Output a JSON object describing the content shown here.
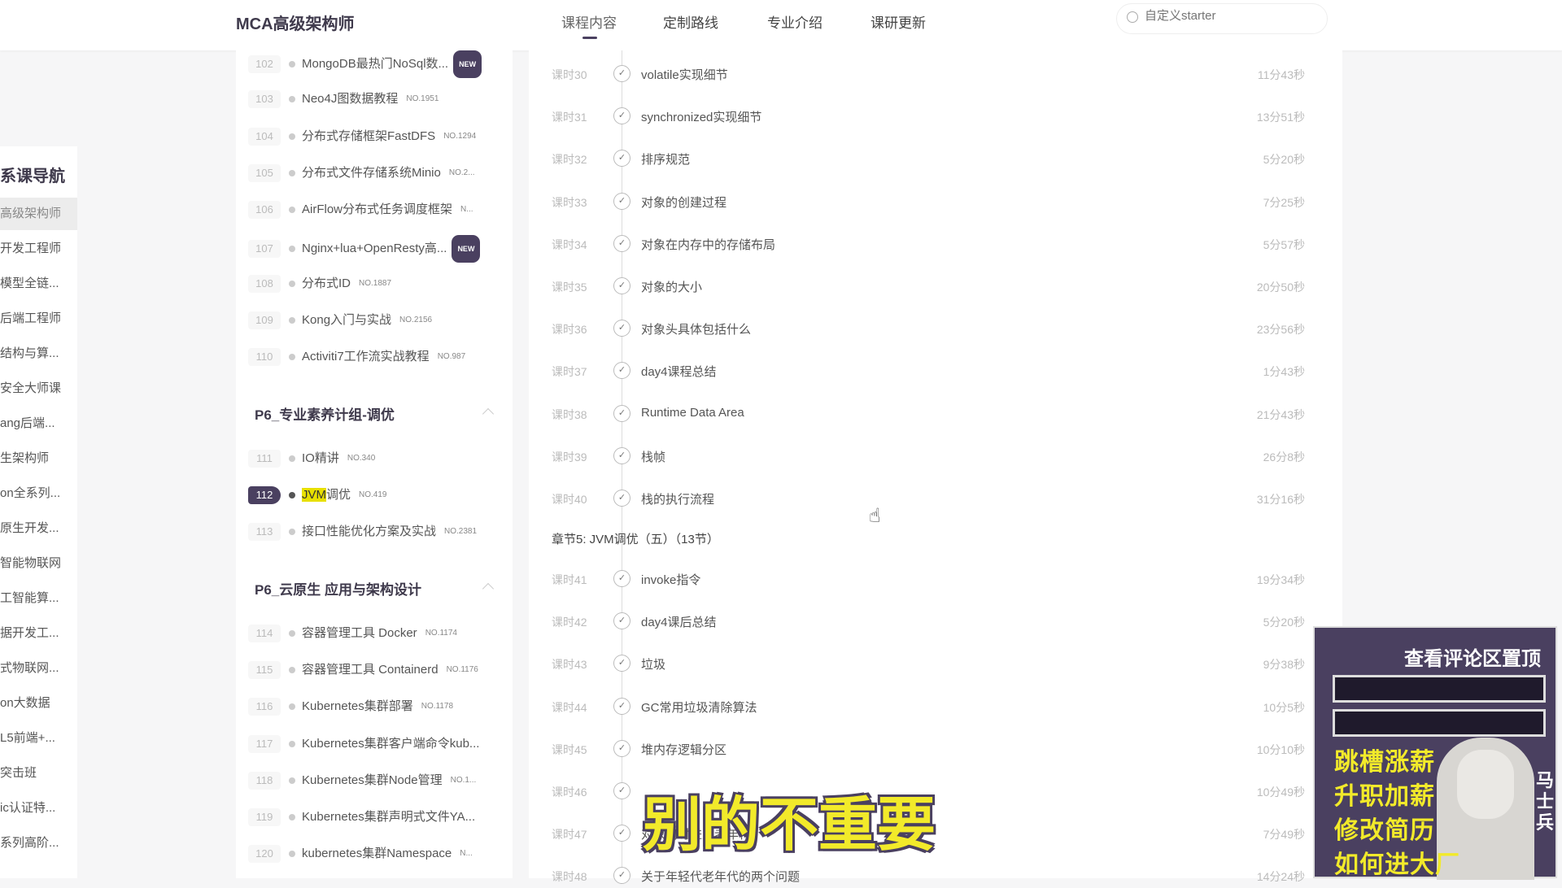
{
  "header": {
    "title": "MCA高级架构师",
    "tabs": [
      "课程内容",
      "定制路线",
      "专业介绍",
      "课研更新"
    ],
    "active_tab": 0,
    "search_placeholder": "自定义starter"
  },
  "sidebar": {
    "title": "系课导航",
    "items": [
      "高级架构师",
      "开发工程师",
      "模型全链...",
      "后端工程师",
      "结构与算...",
      "安全大师课",
      "ang后端...",
      "生架构师",
      "on全系列...",
      "原生开发...",
      "智能物联网",
      "工智能算...",
      "据开发工...",
      "式物联网...",
      "on大数据",
      "L5前端+...",
      "突击班",
      "ic认证特...",
      "系列高阶..."
    ],
    "selected": 0
  },
  "courses": {
    "items": [
      {
        "num": "102",
        "title": "MongoDB最热门NoSql数...",
        "no": "",
        "badge": "NEW"
      },
      {
        "num": "103",
        "title": "Neo4J图数据教程",
        "no": "NO.1951"
      },
      {
        "num": "104",
        "title": "分布式存储框架FastDFS",
        "no": "NO.1294"
      },
      {
        "num": "105",
        "title": "分布式文件存储系统Minio",
        "no": "NO.2..."
      },
      {
        "num": "106",
        "title": "AirFlow分布式任务调度框架",
        "no": "N..."
      },
      {
        "num": "107",
        "title": "Nginx+lua+OpenResty高...",
        "no": "",
        "badge": "NEW"
      },
      {
        "num": "108",
        "title": "分布式ID",
        "no": "NO.1887"
      },
      {
        "num": "109",
        "title": "Kong入门与实战",
        "no": "NO.2156"
      },
      {
        "num": "110",
        "title": "Activiti7工作流实战教程",
        "no": "NO.987"
      },
      {
        "section": "P6_专业素养计组-调优"
      },
      {
        "num": "111",
        "title": "IO精讲",
        "no": "NO.340"
      },
      {
        "num": "112",
        "title": "JVM调优",
        "highlight": "JVM",
        "rest": "调优",
        "no": "NO.419",
        "selected": true
      },
      {
        "num": "113",
        "title": "接口性能优化方案及实战",
        "no": "NO.2381"
      },
      {
        "section": "P6_云原生 应用与架构设计"
      },
      {
        "num": "114",
        "title": "容器管理工具 Docker",
        "no": "NO.1174"
      },
      {
        "num": "115",
        "title": "容器管理工具 Containerd",
        "no": "NO.1176"
      },
      {
        "num": "116",
        "title": "Kubernetes集群部署",
        "no": "NO.1178"
      },
      {
        "num": "117",
        "title": "Kubernetes集群客户端命令kub...",
        "no": ""
      },
      {
        "num": "118",
        "title": "Kubernetes集群Node管理",
        "no": "NO.1..."
      },
      {
        "num": "119",
        "title": "Kubernetes集群声明式文件YA...",
        "no": ""
      },
      {
        "num": "120",
        "title": "kubernetes集群Namespace",
        "no": "N..."
      }
    ]
  },
  "lessons_a": [
    {
      "no": "课时30",
      "title": "volatile实现细节",
      "dur": "11分43秒"
    },
    {
      "no": "课时31",
      "title": "synchronized实现细节",
      "dur": "13分51秒"
    },
    {
      "no": "课时32",
      "title": "排序规范",
      "dur": "5分20秒"
    },
    {
      "no": "课时33",
      "title": "对象的创建过程",
      "dur": "7分25秒"
    },
    {
      "no": "课时34",
      "title": "对象在内存中的存储布局",
      "dur": "5分57秒"
    },
    {
      "no": "课时35",
      "title": "对象的大小",
      "dur": "20分50秒"
    },
    {
      "no": "课时36",
      "title": "对象头具体包括什么",
      "dur": "23分56秒"
    },
    {
      "no": "课时37",
      "title": "day4课程总结",
      "dur": "1分43秒"
    },
    {
      "no": "课时38",
      "title": "Runtime Data Area",
      "dur": "21分43秒"
    },
    {
      "no": "课时39",
      "title": "栈帧",
      "dur": "26分8秒"
    },
    {
      "no": "课时40",
      "title": "栈的执行流程",
      "dur": "31分16秒"
    }
  ],
  "chapter": "章节5: JVM调优（五）（13节）",
  "lessons_b": [
    {
      "no": "课时41",
      "title": "invoke指令",
      "dur": "19分34秒"
    },
    {
      "no": "课时42",
      "title": "day4课后总结",
      "dur": "5分20秒"
    },
    {
      "no": "课时43",
      "title": "垃圾",
      "dur": "9分38秒"
    },
    {
      "no": "课时44",
      "title": "GC常用垃圾清除算法",
      "dur": "10分5秒"
    },
    {
      "no": "课时45",
      "title": "堆内存逻辑分区",
      "dur": "10分10秒"
    },
    {
      "no": "课时46",
      "title": "",
      "dur": "10分49秒"
    },
    {
      "no": "课时47",
      "title": "对象何时进入老年代",
      "dur": "7分49秒"
    },
    {
      "no": "课时48",
      "title": "关于年轻代老年代的两个问题",
      "dur": "14分24秒"
    }
  ],
  "subtitle": "别的不重要",
  "ad": {
    "top": "查看评论区置顶",
    "lines": [
      "跳槽涨薪",
      "升职加薪",
      "修改简历",
      "如何进大厂"
    ],
    "name": "马士兵"
  },
  "colors": {
    "accent": "#4a4060",
    "highlight": "#e8e000",
    "subtitle": "#f2ea2a"
  }
}
